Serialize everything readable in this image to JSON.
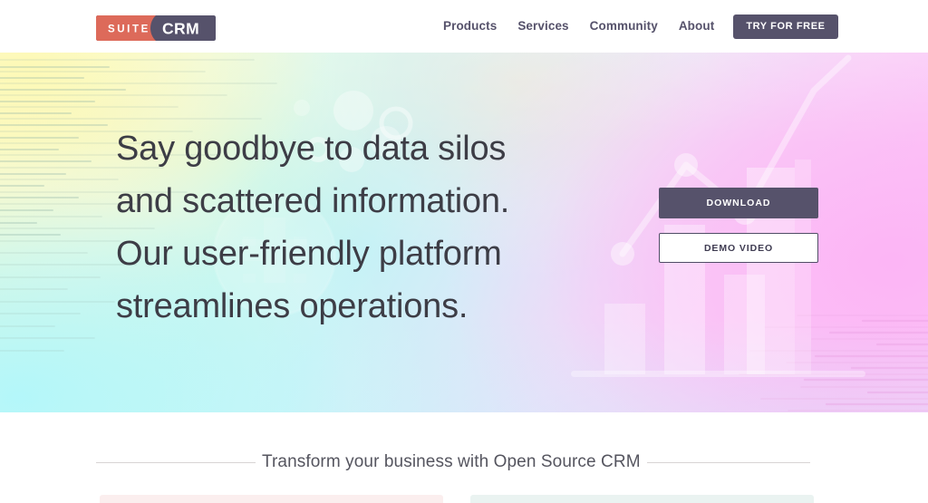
{
  "header": {
    "logo": {
      "suite": "SUITE",
      "crm": "CRM",
      "suite_color": "#dd6a5a",
      "crm_color": "#56526b"
    },
    "nav": [
      {
        "label": "Products"
      },
      {
        "label": "Services"
      },
      {
        "label": "Community"
      },
      {
        "label": "About"
      }
    ],
    "cta": {
      "label": "TRY FOR FREE",
      "bg": "#56526b",
      "text_color": "#ffffff"
    }
  },
  "hero": {
    "headline_lines": [
      "Say goodbye to data silos",
      "and scattered information.",
      "Our user-friendly platform",
      "streamlines operations."
    ],
    "buttons": {
      "primary": {
        "label": "DOWNLOAD",
        "bg": "#56526b",
        "text_color": "#ffffff"
      },
      "secondary": {
        "label": "DEMO VIDEO",
        "bg": "#ffffff",
        "text_color": "#3f3c52",
        "border_color": "#504d66"
      }
    },
    "carousel": {
      "total": 3,
      "active_index": 0,
      "active_color": "#5f5c72",
      "inactive_color": "#a7a6b8"
    },
    "gradient": {
      "top_left": "#fdf8b8",
      "bottom_left": "#b8f5f5",
      "right": "#fcc2f5",
      "mid": "#d8eaf8"
    },
    "decor": {
      "chart_bar_color": "rgba(255,255,255,0.34)",
      "chart_line_color": "rgba(255,255,255,0.42)",
      "line_stripe_color_left": "rgba(150,180,170,0.22)",
      "line_stripe_color_right": "rgba(222,150,215,0.28)"
    }
  },
  "below": {
    "tagline": "Transform your business with Open Source CRM",
    "rule_color": "#d8d4d4",
    "cards": [
      {
        "accent": "#fbeeee"
      },
      {
        "accent": "#eaf3f1"
      }
    ]
  }
}
